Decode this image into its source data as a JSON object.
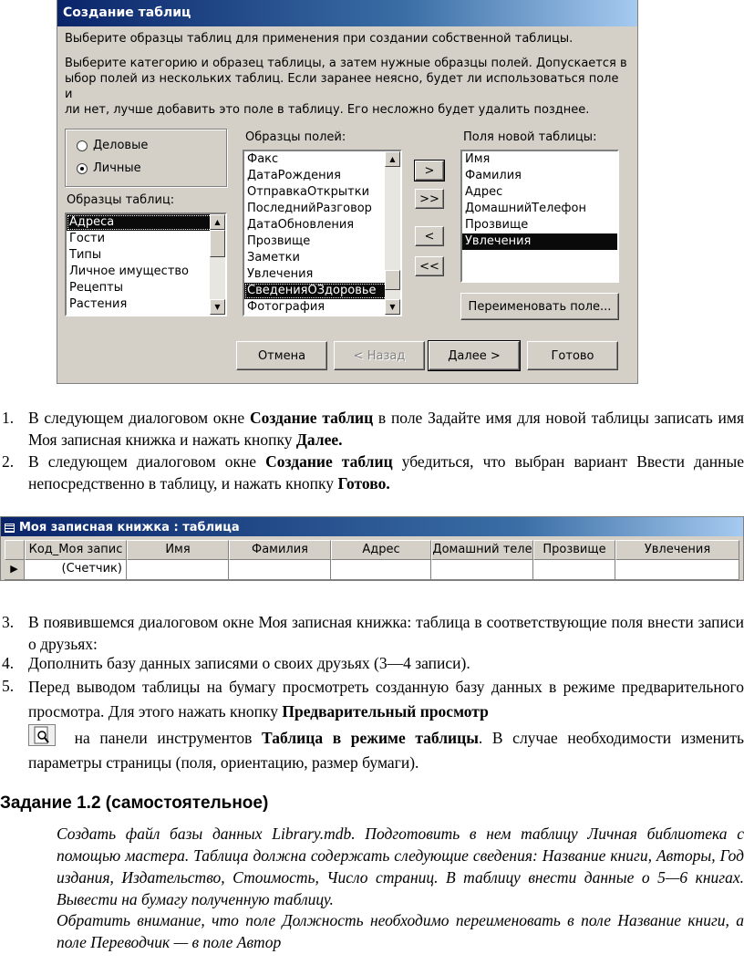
{
  "dialog": {
    "title": "Создание таблиц",
    "subtitle": "Выберите образцы таблиц для применения при создании собственной таблицы.",
    "description": "Выберите категорию и образец таблицы, а затем нужные образцы полей. Допускается в\nыбор полей из нескольких таблиц. Если заранее неясно, будет ли использоваться поле и\nли нет, лучше добавить это поле в таблицу. Его несложно будет удалить позднее.",
    "radio_business": "Деловые",
    "radio_personal": "Личные",
    "tables_label": "Образцы таблиц:",
    "tables": [
      "Адреса",
      "Гости",
      "Типы",
      "Личное имущество",
      "Рецепты",
      "Растения"
    ],
    "fields_label": "Образцы полей:",
    "fields": [
      "Факс",
      "ДатаРождения",
      "ОтправкаОткрытки",
      "ПоследнийРазговор",
      "ДатаОбновления",
      "Прозвище",
      "Заметки",
      "Увлечения",
      "СведенияОЗдоровье",
      "Фотография"
    ],
    "new_fields_label": "Поля новой таблицы:",
    "new_fields": [
      "Имя",
      "Фамилия",
      "Адрес",
      "ДомашнийТелефон",
      "Прозвище",
      "Увлечения"
    ],
    "btn_add_one": ">",
    "btn_add_all": ">>",
    "btn_remove_one": "<",
    "btn_remove_all": "<<",
    "btn_rename": "Переименовать поле...",
    "btn_cancel": "Отмена",
    "btn_back": "< Назад",
    "btn_next": "Далее >",
    "btn_finish": "Готово"
  },
  "steps_a": [
    {
      "num": "1.",
      "pre": "В следующем диалоговом окне ",
      "b1": "Создание таблиц",
      "mid": " в поле Задайте имя для новой таблицы записать имя Моя записная книжка и нажать кнопку ",
      "b2": "Далее."
    },
    {
      "num": "2.",
      "pre": "В следующем диалоговом окне ",
      "b1": "Создание таблиц",
      "mid": " убедиться, что выбран вариант Ввести данные непосредственно в таблицу, и нажать кнопку ",
      "b2": "Готово."
    }
  ],
  "datasheet": {
    "title": "Моя записная книжка : таблица",
    "columns": [
      "Код_Моя запис",
      "Имя",
      "Фамилия",
      "Адрес",
      "Домашний теле",
      "Прозвище",
      "Увлечения"
    ],
    "row_marker": "▶",
    "counter": "(Счетчик)"
  },
  "steps_b": {
    "s3_num": "3.",
    "s3": "В появившемся диалоговом окне Моя записная книжка: таблица в соответствующие поля внести записи о друзьях:",
    "s4_num": "4.",
    "s4": "Дополнить базу данных записями о своих друзьях (3—4 записи).",
    "s5_num": "5.",
    "s5_pre": "Перед выводом таблицы на бумагу просмотреть созданную базу данных в режиме предварительного просмотра. Для этого нажать кнопку ",
    "s5_b1": "Предварительный просмотр",
    "s5_mid": " на панели инструментов ",
    "s5_b2": "Таблица в режиме таблицы",
    "s5_post": ". В случае необходимости изменить параметры страницы (поля, ориентацию, размер бумаги)."
  },
  "task": {
    "heading": "Задание 1.2 (самостоятельное)",
    "p1": "Создать файл базы данных Library.mdb. Подготовить в нем таблицу Личная библиотека с помощью мастера. Таблица должна содержать следующие сведения: Название книги, Авторы, Год издания, Издательство, Стоимость, Число страниц. В таблицу внести данные о 5—6 книгах. Вывести на бумагу полученную таблицу.",
    "p2": "Обратить внимание, что поле Должность необходимо переименовать в поле Название книги, а поле Переводчик — в поле Автор"
  },
  "icons": {
    "preview": "print-preview-icon",
    "table": "table-icon"
  }
}
